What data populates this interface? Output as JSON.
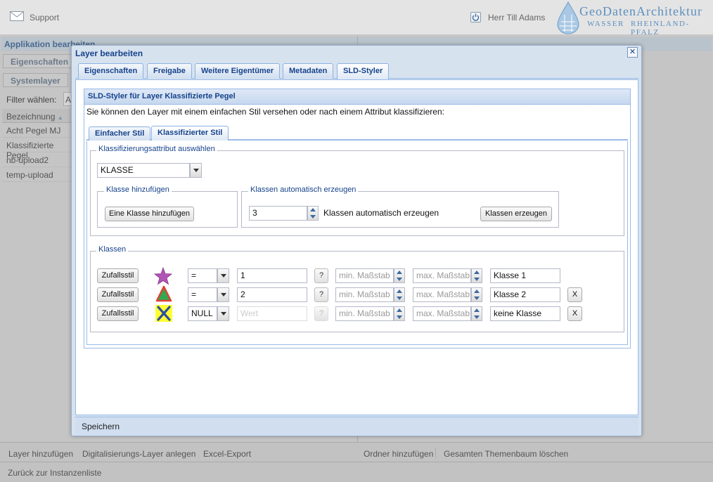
{
  "header": {
    "support_label": "Support",
    "user_label": "Herr Till Adams",
    "logo": {
      "line1": "GeoDatenArchitektur",
      "line2": "WASSER",
      "line3": "RHEINLAND-PFALZ"
    }
  },
  "background": {
    "app_title": "Applikation bearbeiten",
    "tab1": "Eigenschaften",
    "tab2": "Systemlayer",
    "filter_label": "Filter wählen:",
    "filter_value": "A",
    "column_header": "Bezeichnung",
    "rows": [
      "Acht Pegel MJ",
      "Klassifizierte Pegel",
      "nb-upload2",
      "temp-upload"
    ],
    "bottom_left": [
      "Layer hinzufügen",
      "Digitalisierungs-Layer anlegen",
      "Excel-Export"
    ],
    "bottom_right": [
      "Ordner hinzufügen",
      "Gesamten Themenbaum löschen"
    ],
    "back_link": "Zurück zur Instanzenliste"
  },
  "dialog": {
    "title": "Layer bearbeiten",
    "close": "✕",
    "tabs": [
      "Eigenschaften",
      "Freigabe",
      "Weitere Eigentümer",
      "Metadaten",
      "SLD-Styler"
    ],
    "active_tab": "SLD-Styler",
    "save_label": "Speichern",
    "panel": {
      "title": "SLD-Styler für Layer Klassifizierte Pegel",
      "intro": "Sie können den Layer mit einem einfachen Stil versehen oder nach einem Attribut klassifizieren:",
      "subtabs": [
        "Einfacher Stil",
        "Klassifizierter Stil"
      ],
      "active_subtab": "Klassifizierter Stil",
      "attr_legend": "Klassifizierungsattribut auswählen",
      "attr_value": "KLASSE",
      "add_legend": "Klasse hinzufügen",
      "add_button": "Eine Klasse hinzufügen",
      "auto_legend": "Klassen automatisch erzeugen",
      "auto_count": "3",
      "auto_text": "Klassen automatisch erzeugen",
      "auto_button": "Klassen erzeugen",
      "classes_legend": "Klassen",
      "random_label": "Zufallsstil",
      "min_placeholder": "min. Maßstab",
      "max_placeholder": "max. Maßstab",
      "value_placeholder": "Wert",
      "help": "?",
      "remove": "X",
      "classes": [
        {
          "symbol": "star-icon",
          "operator": "=",
          "value": "1",
          "name": "Klasse 1"
        },
        {
          "symbol": "triangle-icon",
          "operator": "=",
          "value": "2",
          "name": "Klasse 2"
        },
        {
          "symbol": "x-icon",
          "operator": "NULL",
          "value": "",
          "name": "keine Klasse"
        }
      ]
    }
  },
  "colors": {
    "accent": "#15428b",
    "border": "#99bbe8",
    "star": "#b055b5",
    "triangle_fill": "#33a852",
    "triangle_stroke": "#e04030",
    "x_bg": "#ffff33",
    "x_stroke": "#2e4fa0"
  }
}
